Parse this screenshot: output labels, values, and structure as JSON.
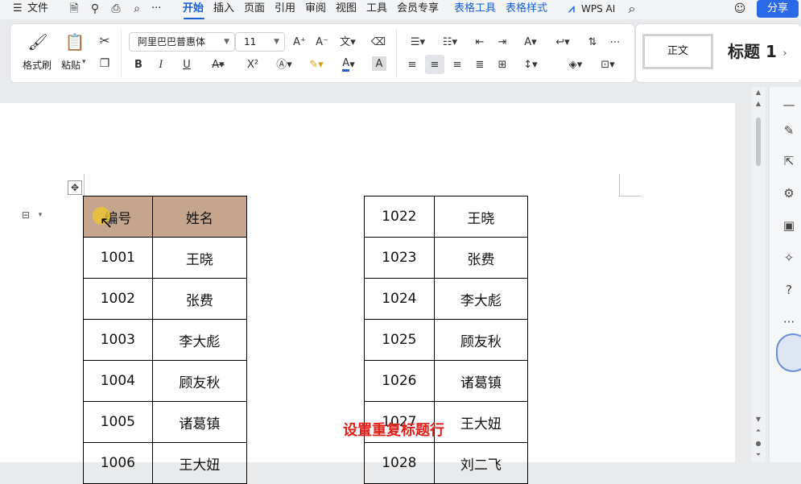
{
  "menu": {
    "file": "文件",
    "tabs": [
      "开始",
      "插入",
      "页面",
      "引用",
      "审阅",
      "视图",
      "工具",
      "会员专享"
    ],
    "context_tabs": [
      "表格工具",
      "表格样式"
    ],
    "wps_ai": "WPS AI",
    "share": "分享",
    "more": "···"
  },
  "ribbon": {
    "format_painter": "格式刷",
    "paste": "粘贴",
    "font_name": "阿里巴巴普惠体",
    "font_size": "11",
    "bold": "B",
    "italic": "I",
    "underline": "U",
    "superscript": "X²",
    "style_normal": "正文",
    "style_heading": "标题 1"
  },
  "table_left": {
    "header": [
      "编号",
      "姓名"
    ],
    "rows": [
      [
        "1001",
        "王晓"
      ],
      [
        "1002",
        "张费"
      ],
      [
        "1003",
        "李大彪"
      ],
      [
        "1004",
        "顾友秋"
      ],
      [
        "1005",
        "诸葛镇"
      ],
      [
        "1006",
        "王大妞"
      ]
    ]
  },
  "table_right": {
    "rows": [
      [
        "1022",
        "王晓"
      ],
      [
        "1023",
        "张费"
      ],
      [
        "1024",
        "李大彪"
      ],
      [
        "1025",
        "顾友秋"
      ],
      [
        "1026",
        "诸葛镇"
      ],
      [
        "1027",
        "王大妞"
      ],
      [
        "1028",
        "刘二飞"
      ]
    ]
  },
  "caption": "设置重复标题行",
  "colors": {
    "accent": "#1a5fd6",
    "header_fill": "#c5a58e",
    "caption": "#e0201b"
  }
}
